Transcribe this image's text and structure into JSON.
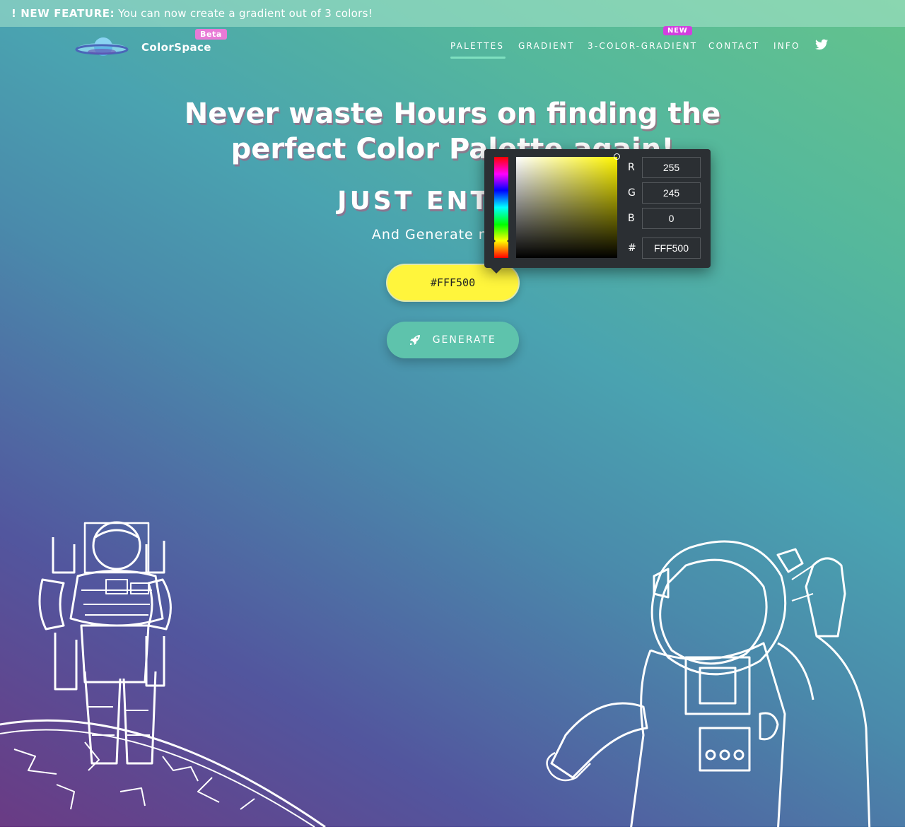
{
  "announcement": {
    "prefix": "! NEW FEATURE:",
    "text": "You can now create a gradient out of 3 colors!"
  },
  "brand": {
    "name": "ColorSpace",
    "badge": "Beta",
    "logo_icon": "planet-icon"
  },
  "nav": {
    "items": [
      {
        "label": "PALETTES",
        "active": true
      },
      {
        "label": "GRADIENT",
        "active": false
      },
      {
        "label": "3-COLOR-GRADIENT",
        "active": false,
        "badge": "NEW"
      },
      {
        "label": "CONTACT",
        "active": false
      },
      {
        "label": "INFO",
        "active": false
      }
    ],
    "social_icon": "twitter-icon"
  },
  "hero": {
    "headline_line1": "Never waste Hours on finding the",
    "headline_line2": "perfect Color Palette again!",
    "subhead": "JUST ENTER A",
    "tagline": "And Generate nice Co"
  },
  "color_input": {
    "value": "#FFF500"
  },
  "generate_button": {
    "label": "GENERATE",
    "icon": "rocket-icon"
  },
  "color_picker": {
    "r_label": "R",
    "r_value": "255",
    "g_label": "G",
    "g_value": "245",
    "b_label": "B",
    "b_value": "0",
    "hex_label": "#",
    "hex_value": "FFF500",
    "selected_color": "#fff500"
  },
  "colors": {
    "accent": "#64c38c",
    "button": "#5ec3ac",
    "input": "#fff53c",
    "beta_badge": "#e87ad6",
    "new_badge": "#d33ee0"
  }
}
